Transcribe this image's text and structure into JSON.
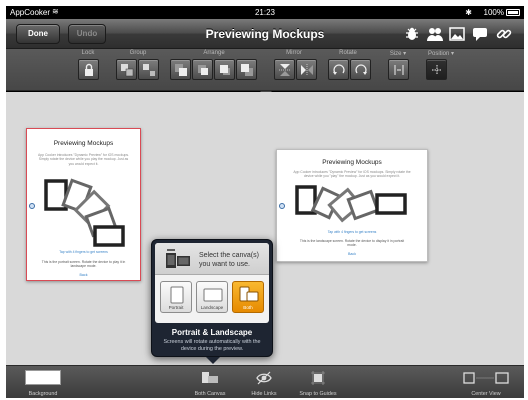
{
  "statusbar": {
    "carrier": "AppCooker",
    "time": "21:23",
    "battery": "100%"
  },
  "navbar": {
    "done_label": "Done",
    "undo_label": "Undo",
    "title": "Previewing Mockups",
    "icons": [
      "bug-icon",
      "users-icon",
      "image-icon",
      "chat-icon",
      "link-icon"
    ]
  },
  "toolbar": {
    "groups": {
      "lock": "Lock",
      "group": "Group",
      "arrange": "Arrange",
      "mirror": "Mirror",
      "rotate": "Rotate",
      "size": "Size ▾",
      "position": "Position ▾"
    }
  },
  "canvas": {
    "portrait_card": {
      "title": "Previewing Mockups",
      "intro": "App Cooker introduces \"Dynamic Preview\" for iOS mockups. Simply rotate the device while you play the mockup. Just as you would expect it.",
      "hint": "Tap with 4 fingers to get screens",
      "footer": "This is the portrait screen. Rotate the device to play it in landscape mode.",
      "link": "Back"
    },
    "landscape_card": {
      "title": "Previewing Mockups",
      "intro": "App Cooker introduces \"Dynamic Preview\" for iOS mockups. Simply rotate the device while you \"play\" the mockup. Just as you would expect it.",
      "hint": "Tap with 4 fingers to get screens",
      "footer": "This is the landscape screen. Rotate the device to display it in portrait mode.",
      "link": "Back"
    }
  },
  "popover": {
    "prompt": "Select the canva(s) you want to use.",
    "options": [
      "Portrait",
      "Landscape",
      "Both"
    ],
    "selected": "Both",
    "mode_title": "Portrait & Landscape",
    "description": "Screens will rotate automatically with the device during the preview."
  },
  "bottombar": {
    "background_label": "Background",
    "canvas_label": "Both Canvas",
    "links_label": "Hide Links",
    "snap_label": "Snap to Guides",
    "center_label": "Center View"
  },
  "colors": {
    "accent_orange": "#f2a21e",
    "portrait_border": "#d84b55",
    "link_blue": "#3a84c8",
    "popover_bg": "#1e2532"
  }
}
